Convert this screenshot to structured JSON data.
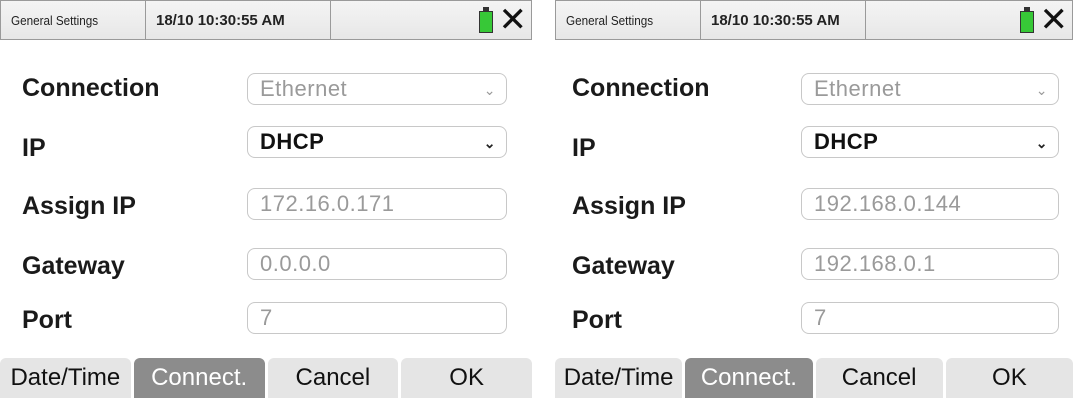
{
  "panels": [
    {
      "title": "General Settings",
      "datetime": "18/10 10:30:55 AM",
      "fields": {
        "connection": {
          "label": "Connection",
          "value": "Ethernet"
        },
        "ip": {
          "label": "IP",
          "value": "DHCP"
        },
        "assign_ip": {
          "label": "Assign IP",
          "value": "172.16.0.171"
        },
        "gateway": {
          "label": "Gateway",
          "value": "0.0.0.0"
        },
        "port": {
          "label": "Port",
          "value": "7"
        }
      },
      "tabs": [
        "Date/Time",
        "Connect.",
        "Cancel",
        "OK"
      ],
      "active_tab": "Connect."
    },
    {
      "title": "General Settings",
      "datetime": "18/10 10:30:55 AM",
      "fields": {
        "connection": {
          "label": "Connection",
          "value": "Ethernet"
        },
        "ip": {
          "label": "IP",
          "value": "DHCP"
        },
        "assign_ip": {
          "label": "Assign IP",
          "value": "192.168.0.144"
        },
        "gateway": {
          "label": "Gateway",
          "value": "192.168.0.1"
        },
        "port": {
          "label": "Port",
          "value": "7"
        }
      },
      "tabs": [
        "Date/Time",
        "Connect.",
        "Cancel",
        "OK"
      ],
      "active_tab": "Connect."
    }
  ],
  "icons": {
    "battery": "battery-icon",
    "close": "close-icon",
    "dropdown": "chevron-down-icon"
  },
  "colors": {
    "active_tab": "#8c8c8c",
    "inactive_tab": "#e5e5e5",
    "battery": "#37c837"
  }
}
